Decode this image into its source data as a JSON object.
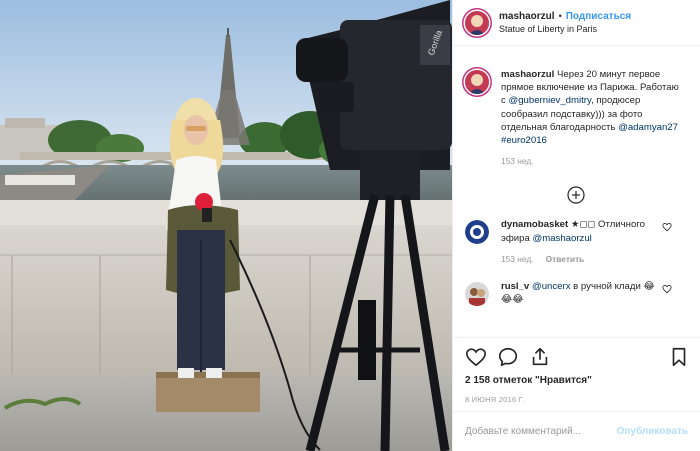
{
  "post": {
    "username": "mashaorzul",
    "separator": "•",
    "follow_label": "Подписаться",
    "location": "Statue of Liberty in Paris"
  },
  "caption": {
    "username": "mashaorzul",
    "text_part1": "Через 20 минут первое прямое включение из Парижа. Работаю с ",
    "mention1": "@guberniev_dmitry",
    "text_part2": ", продюсер сообразил подставку))) за фото отдельная благодарность ",
    "mention2": "@adamyan27",
    "hashtag": "#euro2016",
    "time": "153 нед."
  },
  "comments": [
    {
      "username": "dynamobasket",
      "text_part1": "★◻◻ Отличного эфира ",
      "mention": "@mashaorzul",
      "time": "153 нед.",
      "reply_label": "Ответить"
    },
    {
      "username": "rusl_v",
      "mention": "@uncerx",
      "text_part1": " в ручной клади ",
      "emoji": "😂😂😂"
    }
  ],
  "likes": "2 158 отметок \"Нравится\"",
  "date": "8 ИЮНЯ 2016 Г.",
  "add_comment": {
    "placeholder": "Добавьте комментарий...",
    "publish_label": "Опубликовать"
  },
  "icons": {
    "like": "heart-icon",
    "comment": "comment-icon",
    "share": "share-icon",
    "save": "bookmark-icon",
    "load_more": "plus-circle-icon",
    "comment_like": "heart-icon"
  },
  "colors": {
    "link": "#003569",
    "follow": "#3897f0",
    "publish_disabled": "#b2dffc",
    "muted": "#999999"
  }
}
